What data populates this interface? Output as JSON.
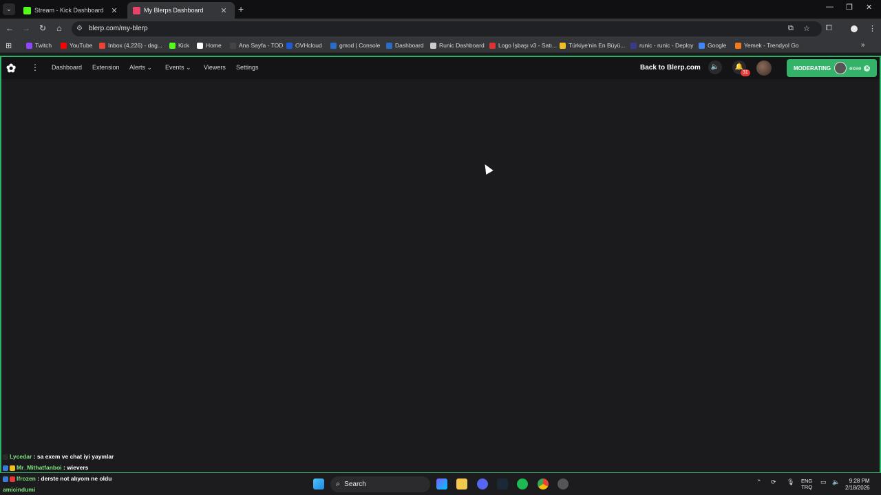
{
  "browser": {
    "tabs": [
      {
        "title": "Stream - Kick Dashboard",
        "favicon_color": "#53fc18"
      },
      {
        "title": "My Blerps Dashboard",
        "favicon_color": "#e8416a"
      }
    ],
    "url": "blerp.com/my-blerp",
    "bookmarks": [
      {
        "label": "Twitch",
        "color": "#9146ff"
      },
      {
        "label": "YouTube",
        "color": "#ff0000"
      },
      {
        "label": "Inbox (4,226) - dag...",
        "color": "#ea4335"
      },
      {
        "label": "Kick",
        "color": "#53fc18"
      },
      {
        "label": "Home",
        "color": "#ffffff"
      },
      {
        "label": "Ana Sayfa - TOD",
        "color": "#444444"
      },
      {
        "label": "OVHcloud",
        "color": "#1f5ad6"
      },
      {
        "label": "gmod | Console",
        "color": "#2a6cc9"
      },
      {
        "label": "Dashboard",
        "color": "#2a6cc9"
      },
      {
        "label": "Runic Dashboard",
        "color": "#cccccc"
      },
      {
        "label": "Logo İşbaşı v3 - Satı...",
        "color": "#d33"
      },
      {
        "label": "Türkiye'nin En Büyü...",
        "color": "#f0c020"
      },
      {
        "label": "runic - runic - Deploy",
        "color": "#3a3a8c"
      },
      {
        "label": "Google",
        "color": "#4285f4"
      },
      {
        "label": "Yemek - Trendyol Go",
        "color": "#f27a1a"
      }
    ]
  },
  "app": {
    "nav": [
      "Dashboard",
      "Extension",
      "Alerts",
      "Events",
      "Viewers",
      "Settings"
    ],
    "back_label": "Back to Blerp.com",
    "notification_count": "31",
    "moderating_label": "MODERATING",
    "moderating_user": "exee"
  },
  "chat": [
    {
      "user": "Lycedar",
      "message": " : sa exem ve chat iyi yayınlar"
    },
    {
      "user": "Mr_Mithatfanboi",
      "message": " : wievers"
    },
    {
      "user": "lfrozen",
      "message": " : derste not alıyom ne oldu"
    },
    {
      "user": "amicindumi",
      "message": ""
    }
  ],
  "taskbar": {
    "search_label": "Search",
    "lang_top": "ENG",
    "lang_bottom": "TRQ",
    "time": "9:28 PM",
    "date": "2/18/2026"
  }
}
